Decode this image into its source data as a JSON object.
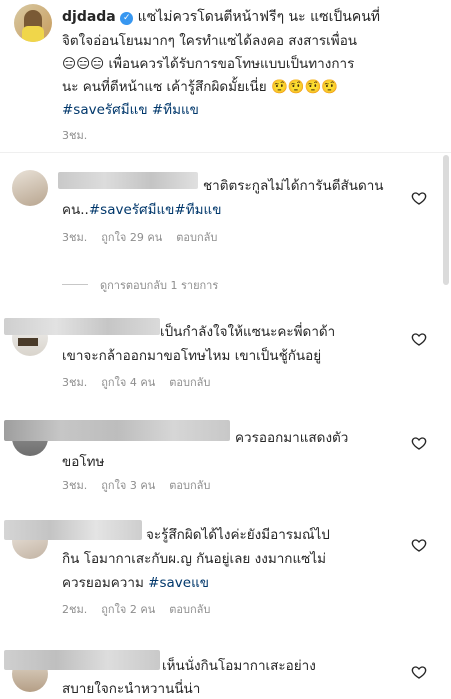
{
  "caption": {
    "username": "djdada",
    "line1": "แซไม่ควรโดนตีหน้าฟรีๆ นะ แซเป็นคนที่",
    "line2": "จิตใจอ่อนโยนมากๆ ใครทำแซได้ลงคอ สงสารเพื่อน",
    "line3": "😑😑😑 เพื่อนควรได้รับการขอโทษแบบเป็นทางการ",
    "line4": "นะ คนที่ตีหน้าแซ เค้ารู้สึกผิดมั้ยเนี่ย 🤨🤨🤨🤨",
    "hashtags": "#saveรัศมีแข #ทีมแข",
    "time": "3ชม."
  },
  "comments": [
    {
      "line1": "ชาติตระกูลไม่ได้การันตีสันดาน",
      "line2_text": "คน..",
      "line2_tags": "#saveรัศมีแข#ทีมแข",
      "time": "3ชม.",
      "likes": "ถูกใจ 29 คน",
      "reply": "ตอบกลับ",
      "view_replies": "ดูการตอบกลับ 1 รายการ"
    },
    {
      "line1": "เป็นกำลังใจให้แซนะคะพี่ดาด้า",
      "line2": "เขาจะกล้าออกมาขอโทษไหม เขาเป็นชู้กันอยู่",
      "time": "3ชม.",
      "likes": "ถูกใจ 4 คน",
      "reply": "ตอบกลับ"
    },
    {
      "line1": "ควรออกมาแสดงตัว",
      "line2": "ขอโทษ",
      "time": "3ชม.",
      "likes": "ถูกใจ 3 คน",
      "reply": "ตอบกลับ"
    },
    {
      "line1": "จะรู้สึกผิดได้ไงค่ะยังมีอารมณ์ไป",
      "line2": "กิน โอมากาเสะกับผ.ญ กันอยู่เลย งงมากแซไม่",
      "line3_text": "ควรยอมความ ",
      "line3_tags": "#saveแข",
      "time": "2ชม.",
      "likes": "ถูกใจ 2 คน",
      "reply": "ตอบกลับ"
    },
    {
      "line1": "เห็นนั่งกินโอมากาเสะอย่าง",
      "line2": "สบายใจกะนำหวานนี่น่า"
    }
  ],
  "colors": {
    "hashtag": "#00376b",
    "meta": "#8e8e8e",
    "verified": "#3897f0"
  }
}
